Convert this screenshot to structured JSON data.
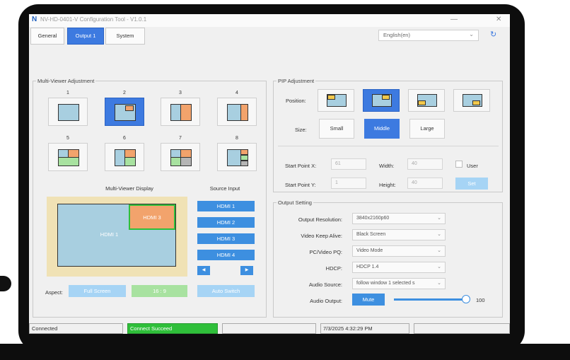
{
  "window": {
    "logo": "N",
    "title": "NV-HD-0401-V Configuration Tool - V1.0.1",
    "minimize": "—",
    "close": "✕"
  },
  "tabs": [
    {
      "label": "General"
    },
    {
      "label": "Output 1"
    },
    {
      "label": "System"
    }
  ],
  "language": {
    "value": "English(en)"
  },
  "icons": {
    "refresh": "refresh-icon",
    "chevron": "chevron-down-icon"
  },
  "multiviewer": {
    "legend": "Multi-Viewer Adjustment",
    "layouts": [
      "1",
      "2",
      "3",
      "4",
      "5",
      "6",
      "7",
      "8"
    ],
    "selected_layout": "2",
    "display_title": "Multi-Viewer Display",
    "source_title": "Source Input",
    "window_main": "HDMI 1",
    "window_pip": "HDMI 3",
    "sources": [
      "HDMI 1",
      "HDMI 2",
      "HDMI 3",
      "HDMI 4"
    ],
    "aspect_label": "Aspect:",
    "aspect_full": "Full Screen",
    "aspect_169": "16 : 9",
    "auto_switch": "Auto Switch"
  },
  "pip": {
    "legend": "PIP Adjustment",
    "position_label": "Position:",
    "size_label": "Size:",
    "sizes": [
      "Small",
      "Middle",
      "Large"
    ],
    "selected_size": "Middle",
    "start_x_label": "Start Point X:",
    "start_x": "61",
    "width_label": "Width:",
    "width": "40",
    "user_label": "User",
    "start_y_label": "Start Point Y:",
    "start_y": "1",
    "height_label": "Height:",
    "height": "40",
    "set_label": "Set"
  },
  "output": {
    "legend": "Output Setting",
    "resolution_label": "Output Resolution:",
    "resolution": "3840x2160p60",
    "keep_alive_label": "Video Keep Alive:",
    "keep_alive": "Black Screen",
    "pq_label": "PC/Video PQ:",
    "pq": "Video Mode",
    "hdcp_label": "HDCP:",
    "hdcp": "HDCP 1.4",
    "audio_source_label": "Audio Source:",
    "audio_source": "follow window 1 selected s",
    "audio_output_label": "Audio Output:",
    "mute_label": "Mute",
    "volume": "100",
    "volume_fraction": 1.0
  },
  "statusbar": {
    "connection": "Connected",
    "result": "Connect Succeed",
    "datetime": "7/3/2025 4:32:29 PM"
  },
  "colors": {
    "accent": "#3d7ae0",
    "button_blue": "#3d8fe0",
    "pip_window": "#f2a36c",
    "window_fill": "#a8cfe0",
    "success": "#2fbf3a"
  }
}
